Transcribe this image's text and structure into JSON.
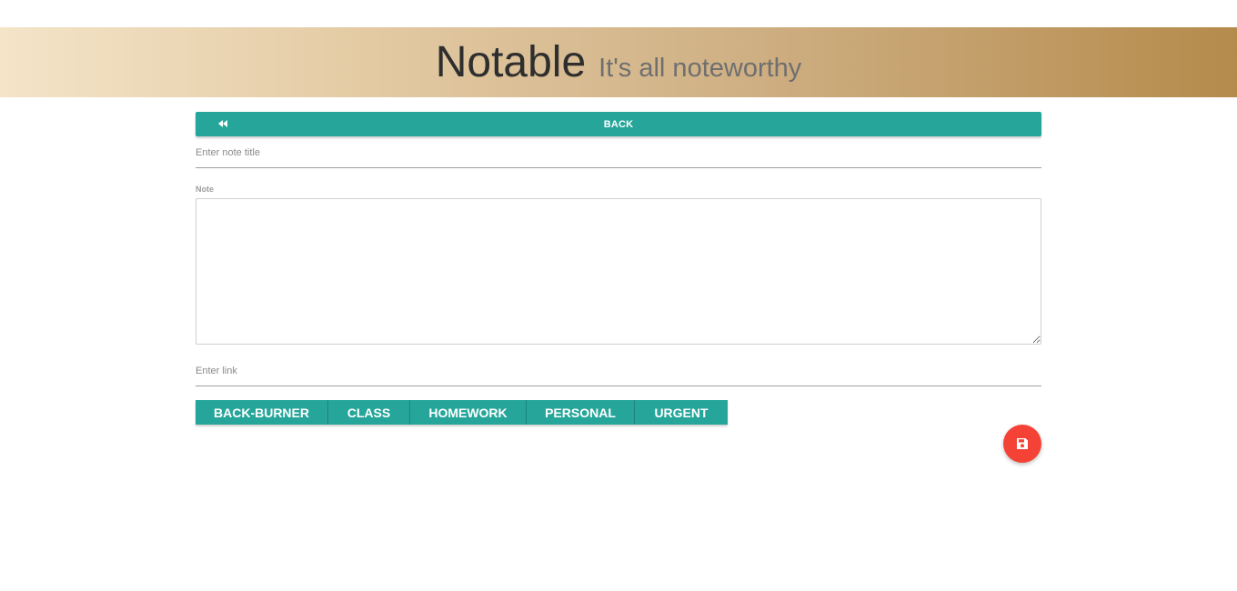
{
  "header": {
    "brand": "Notable",
    "tagline": "It's all noteworthy"
  },
  "back_button": {
    "label": "BACK",
    "icon": "rewind-icon"
  },
  "form": {
    "title_placeholder": "Enter note title",
    "title_value": "",
    "note_label": "Note",
    "note_value": "",
    "link_placeholder": "Enter link",
    "link_value": ""
  },
  "tags": [
    {
      "label": "BACK-BURNER"
    },
    {
      "label": "CLASS"
    },
    {
      "label": "HOMEWORK"
    },
    {
      "label": "PERSONAL"
    },
    {
      "label": "URGENT"
    }
  ],
  "save_button": {
    "icon": "floppy-disk-icon"
  },
  "colors": {
    "accent": "#26a69a",
    "fab": "#f44336",
    "header_gradient_start": "#f4e4c8",
    "header_gradient_end": "#b58b4c"
  }
}
